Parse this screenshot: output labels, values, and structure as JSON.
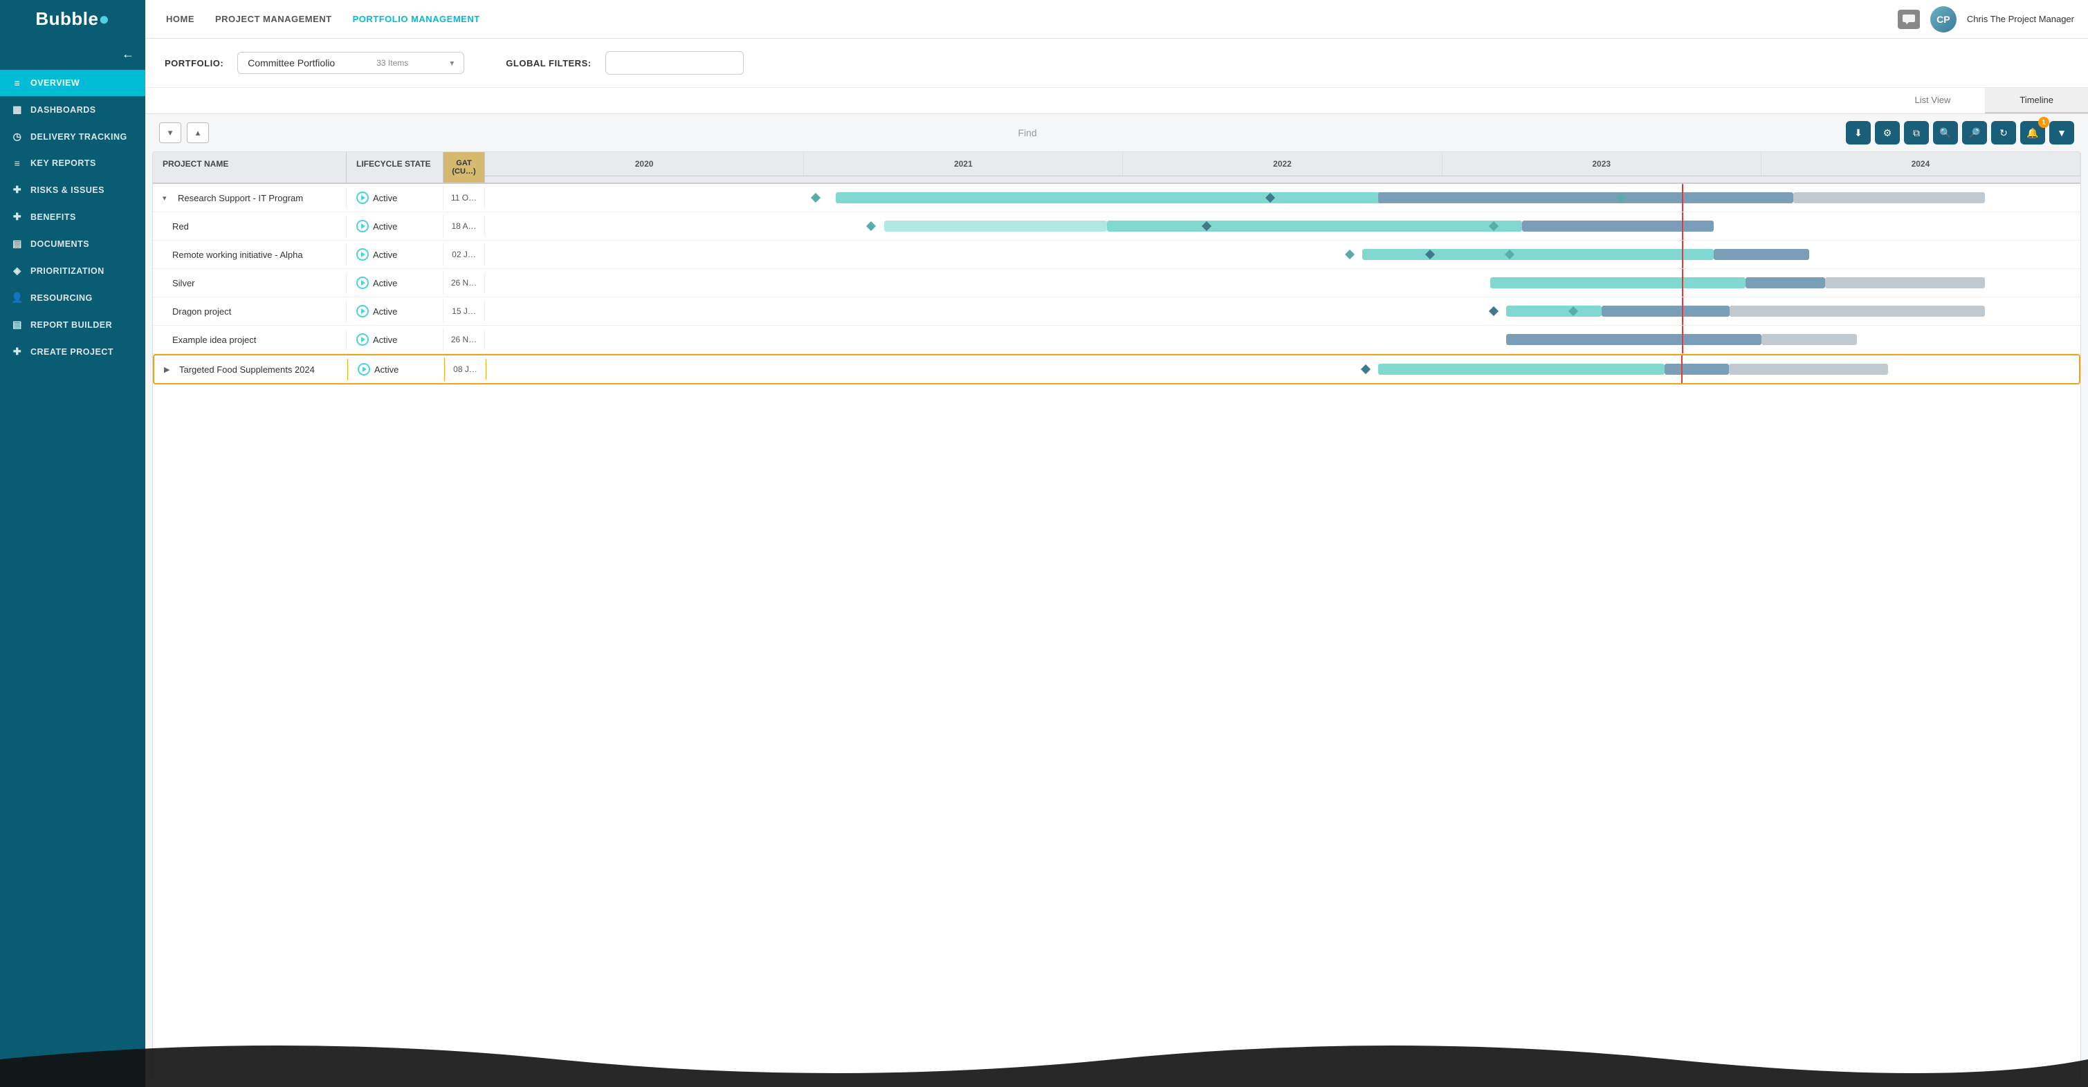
{
  "app": {
    "logo": "Bubble",
    "logo_dot": "●"
  },
  "top_nav": {
    "links": [
      {
        "label": "HOME",
        "active": false
      },
      {
        "label": "PROJECT MANAGEMENT",
        "active": false
      },
      {
        "label": "PORTFOLIO MANAGEMENT",
        "active": true
      }
    ],
    "user_name": "Chris The Project Manager"
  },
  "sidebar": {
    "back_label": "←",
    "items": [
      {
        "label": "OVERVIEW",
        "icon": "≡",
        "active": true
      },
      {
        "label": "DASHBOARDS",
        "icon": "▦",
        "active": false
      },
      {
        "label": "DELIVERY TRACKING",
        "icon": "◷",
        "active": false
      },
      {
        "label": "KEY REPORTS",
        "icon": "≡",
        "active": false
      },
      {
        "label": "RISKS & ISSUES",
        "icon": "✚",
        "active": false
      },
      {
        "label": "BENEFITS",
        "icon": "✚",
        "active": false
      },
      {
        "label": "DOCUMENTS",
        "icon": "▤",
        "active": false
      },
      {
        "label": "PRIORITIZATION",
        "icon": "◈",
        "active": false
      },
      {
        "label": "RESOURCING",
        "icon": "👤",
        "active": false
      },
      {
        "label": "REPORT BUILDER",
        "icon": "▤",
        "active": false
      },
      {
        "label": "CREATE PROJECT",
        "icon": "✚",
        "active": false
      }
    ]
  },
  "portfolio": {
    "label": "PORTFOLIO:",
    "name": "Committee Portfiolio",
    "count": "33 Items",
    "global_filters_label": "GLOBAL FILTERS:"
  },
  "view_tabs": [
    {
      "label": "List View",
      "active": false
    },
    {
      "label": "Timeline",
      "active": true
    }
  ],
  "toolbar": {
    "find_placeholder": "Find",
    "buttons": [
      {
        "icon": "⬇",
        "label": "download"
      },
      {
        "icon": "⚙",
        "label": "settings"
      },
      {
        "icon": "⧉",
        "label": "copy"
      },
      {
        "icon": "🔍",
        "label": "zoom-in"
      },
      {
        "icon": "🔍",
        "label": "zoom-out"
      },
      {
        "icon": "↻",
        "label": "refresh"
      },
      {
        "icon": "🔔",
        "label": "notifications",
        "badge": "1"
      },
      {
        "icon": "▼",
        "label": "filter"
      }
    ]
  },
  "gantt": {
    "columns": {
      "project_name": "PROJECT NAME",
      "lifecycle_state": "LIFECYCLE STATE",
      "gate": "GAT (CU…)"
    },
    "years": [
      "2020",
      "2021",
      "2022",
      "2023",
      "2024"
    ],
    "rows": [
      {
        "name": "Research Support - IT Program",
        "lifecycle": "Active",
        "gate": "11 O…",
        "expandable": true,
        "expanded": true,
        "indent": 0,
        "highlighted": false
      },
      {
        "name": "Red",
        "lifecycle": "Active",
        "gate": "18 A…",
        "expandable": false,
        "expanded": false,
        "indent": 1,
        "highlighted": false
      },
      {
        "name": "Remote working initiative - Alpha",
        "lifecycle": "Active",
        "gate": "02 J…",
        "expandable": false,
        "expanded": false,
        "indent": 1,
        "highlighted": false
      },
      {
        "name": "Silver",
        "lifecycle": "Active",
        "gate": "26 N…",
        "expandable": false,
        "expanded": false,
        "indent": 1,
        "highlighted": false
      },
      {
        "name": "Dragon project",
        "lifecycle": "Active",
        "gate": "15 J…",
        "expandable": false,
        "expanded": false,
        "indent": 1,
        "highlighted": false
      },
      {
        "name": "Example idea project",
        "lifecycle": "Active",
        "gate": "26 N…",
        "expandable": false,
        "expanded": false,
        "indent": 1,
        "highlighted": false
      },
      {
        "name": "Targeted Food Supplements 2024",
        "lifecycle": "Active",
        "gate": "08 J…",
        "expandable": true,
        "expanded": false,
        "indent": 0,
        "highlighted": true
      }
    ]
  }
}
